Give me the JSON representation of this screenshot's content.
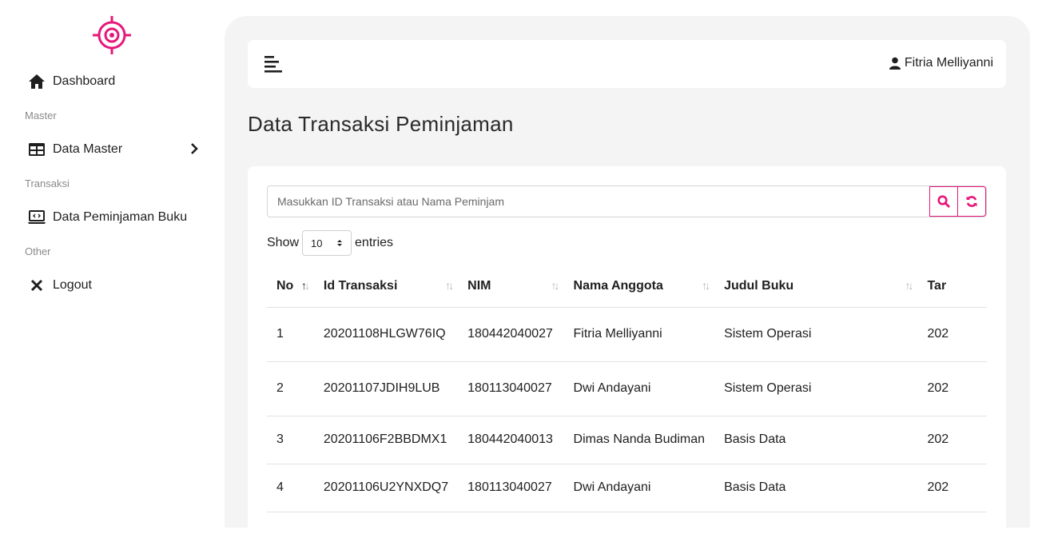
{
  "sidebar": {
    "items": [
      {
        "label": "Dashboard",
        "icon": "home-icon"
      },
      {
        "section": "Master"
      },
      {
        "label": "Data Master",
        "icon": "table-icon"
      },
      {
        "section": "Transaksi"
      },
      {
        "label": "Data Peminjaman Buku",
        "icon": "laptop-code-icon"
      },
      {
        "section": "Other"
      },
      {
        "label": "Logout",
        "icon": "close-icon"
      }
    ]
  },
  "header": {
    "user_name": "Fitria Melliyanni"
  },
  "page": {
    "title": "Data Transaksi Peminjaman"
  },
  "search": {
    "placeholder": "Masukkan ID Transaksi atau Nama Peminjam",
    "value": ""
  },
  "length": {
    "prefix": "Show",
    "selected": "10",
    "suffix": "entries"
  },
  "table": {
    "columns": [
      "No",
      "Id Transaksi",
      "NIM",
      "Nama Anggota",
      "Judul Buku",
      "Tar"
    ],
    "rows": [
      [
        "1",
        "20201108HLGW76IQ",
        "180442040027",
        "Fitria Melliyanni",
        "Sistem Operasi",
        "202"
      ],
      [
        "2",
        "20201107JDIH9LUB",
        "180113040027",
        "Dwi Andayani",
        "Sistem Operasi",
        "202"
      ],
      [
        "3",
        "20201106F2BBDMX1",
        "180442040013",
        "Dimas Nanda Budiman",
        "Basis Data",
        "202"
      ],
      [
        "4",
        "20201106U2YNXDQ7",
        "180113040027",
        "Dwi Andayani",
        "Basis Data",
        "202"
      ]
    ]
  },
  "colors": {
    "accent": "#e6177a",
    "background": "#f4f4f4"
  }
}
